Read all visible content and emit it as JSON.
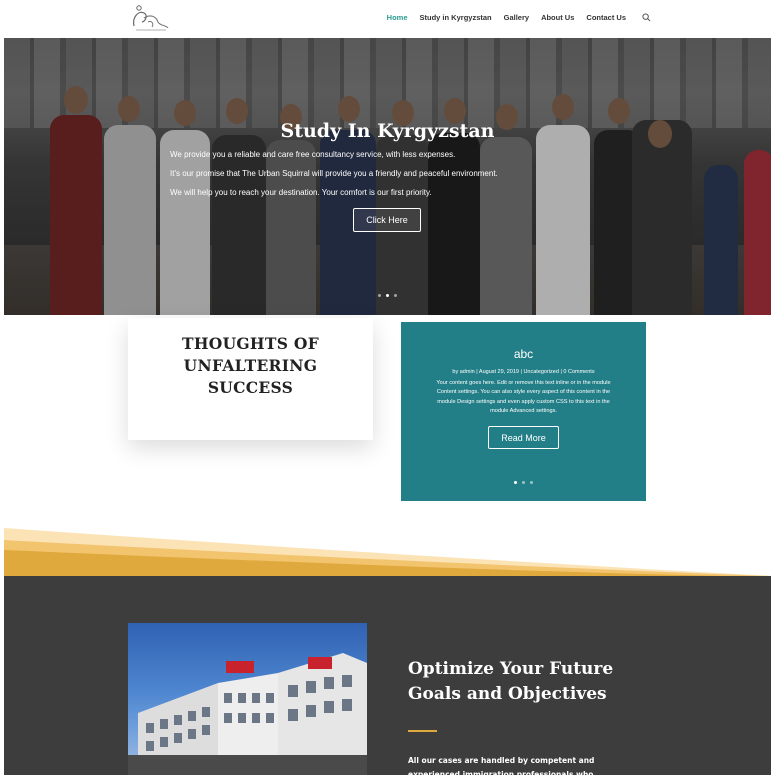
{
  "header": {
    "logo_alt": "The Urban Squirral",
    "nav": [
      {
        "label": "Home",
        "active": true
      },
      {
        "label": "Study in Kyrgyzstan",
        "active": false
      },
      {
        "label": "Gallery",
        "active": false
      },
      {
        "label": "About Us",
        "active": false
      },
      {
        "label": "Contact Us",
        "active": false
      }
    ],
    "search_icon": "search-icon"
  },
  "hero": {
    "title": "Study In Kyrgyzstan",
    "lines": [
      "We provide you a reliable and care free consultancy service, with less expenses.",
      "It's our promise that The Urban Squirral will provide you a friendly and peaceful environment.",
      "We will help you to reach your destination. Your comfort is our first priority."
    ],
    "button_label": "Click Here",
    "slides": 3,
    "active_slide": 2
  },
  "thoughts": {
    "lines": [
      "THOUGHTS OF",
      "UNFALTERING",
      "SUCCESS"
    ]
  },
  "post": {
    "title": "abc",
    "meta": "by admin | August 29, 2019 | Uncategorized | 0 Comments",
    "body": "Your content goes here. Edit or remove this text inline or in the module Content settings. You can also style every aspect of this content in the module Design settings and even apply custom CSS to this text in the module Advanced settings.",
    "button_label": "Read More",
    "slides": 3,
    "active_slide": 1,
    "background": "#237f87"
  },
  "section": {
    "title_lines": [
      "Optimize Your Future",
      "Goals and Objectives"
    ],
    "text": "All our cases are handled by competent and experienced immigration professionals who",
    "accent": "#e0a93e",
    "background": "#3d3d3d"
  },
  "colors": {
    "nav_active": "#2a9d8f",
    "wave_gold": "#f0c070"
  }
}
